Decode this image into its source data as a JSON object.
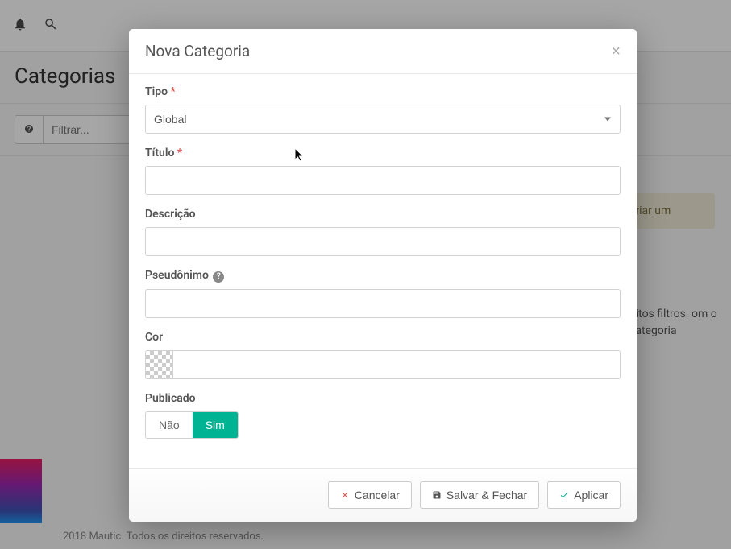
{
  "page": {
    "title": "Categorias"
  },
  "filter": {
    "placeholder": "Filtrar..."
  },
  "hint_box": "criar um",
  "side_text": "uitos filtros. om o categoria",
  "footer": "2018 Mautic. Todos os direitos reservados.",
  "modal": {
    "title": "Nova Categoria",
    "labels": {
      "tipo": "Tipo",
      "titulo": "Título",
      "descricao": "Descrição",
      "pseudonimo": "Pseudônimo",
      "cor": "Cor",
      "publicado": "Publicado"
    },
    "values": {
      "tipo": "Global",
      "titulo": "",
      "descricao": "",
      "pseudonimo": "",
      "cor": ""
    },
    "toggle": {
      "no": "Não",
      "yes": "Sim"
    },
    "buttons": {
      "cancel": "Cancelar",
      "save_close": "Salvar & Fechar",
      "apply": "Aplicar"
    }
  }
}
